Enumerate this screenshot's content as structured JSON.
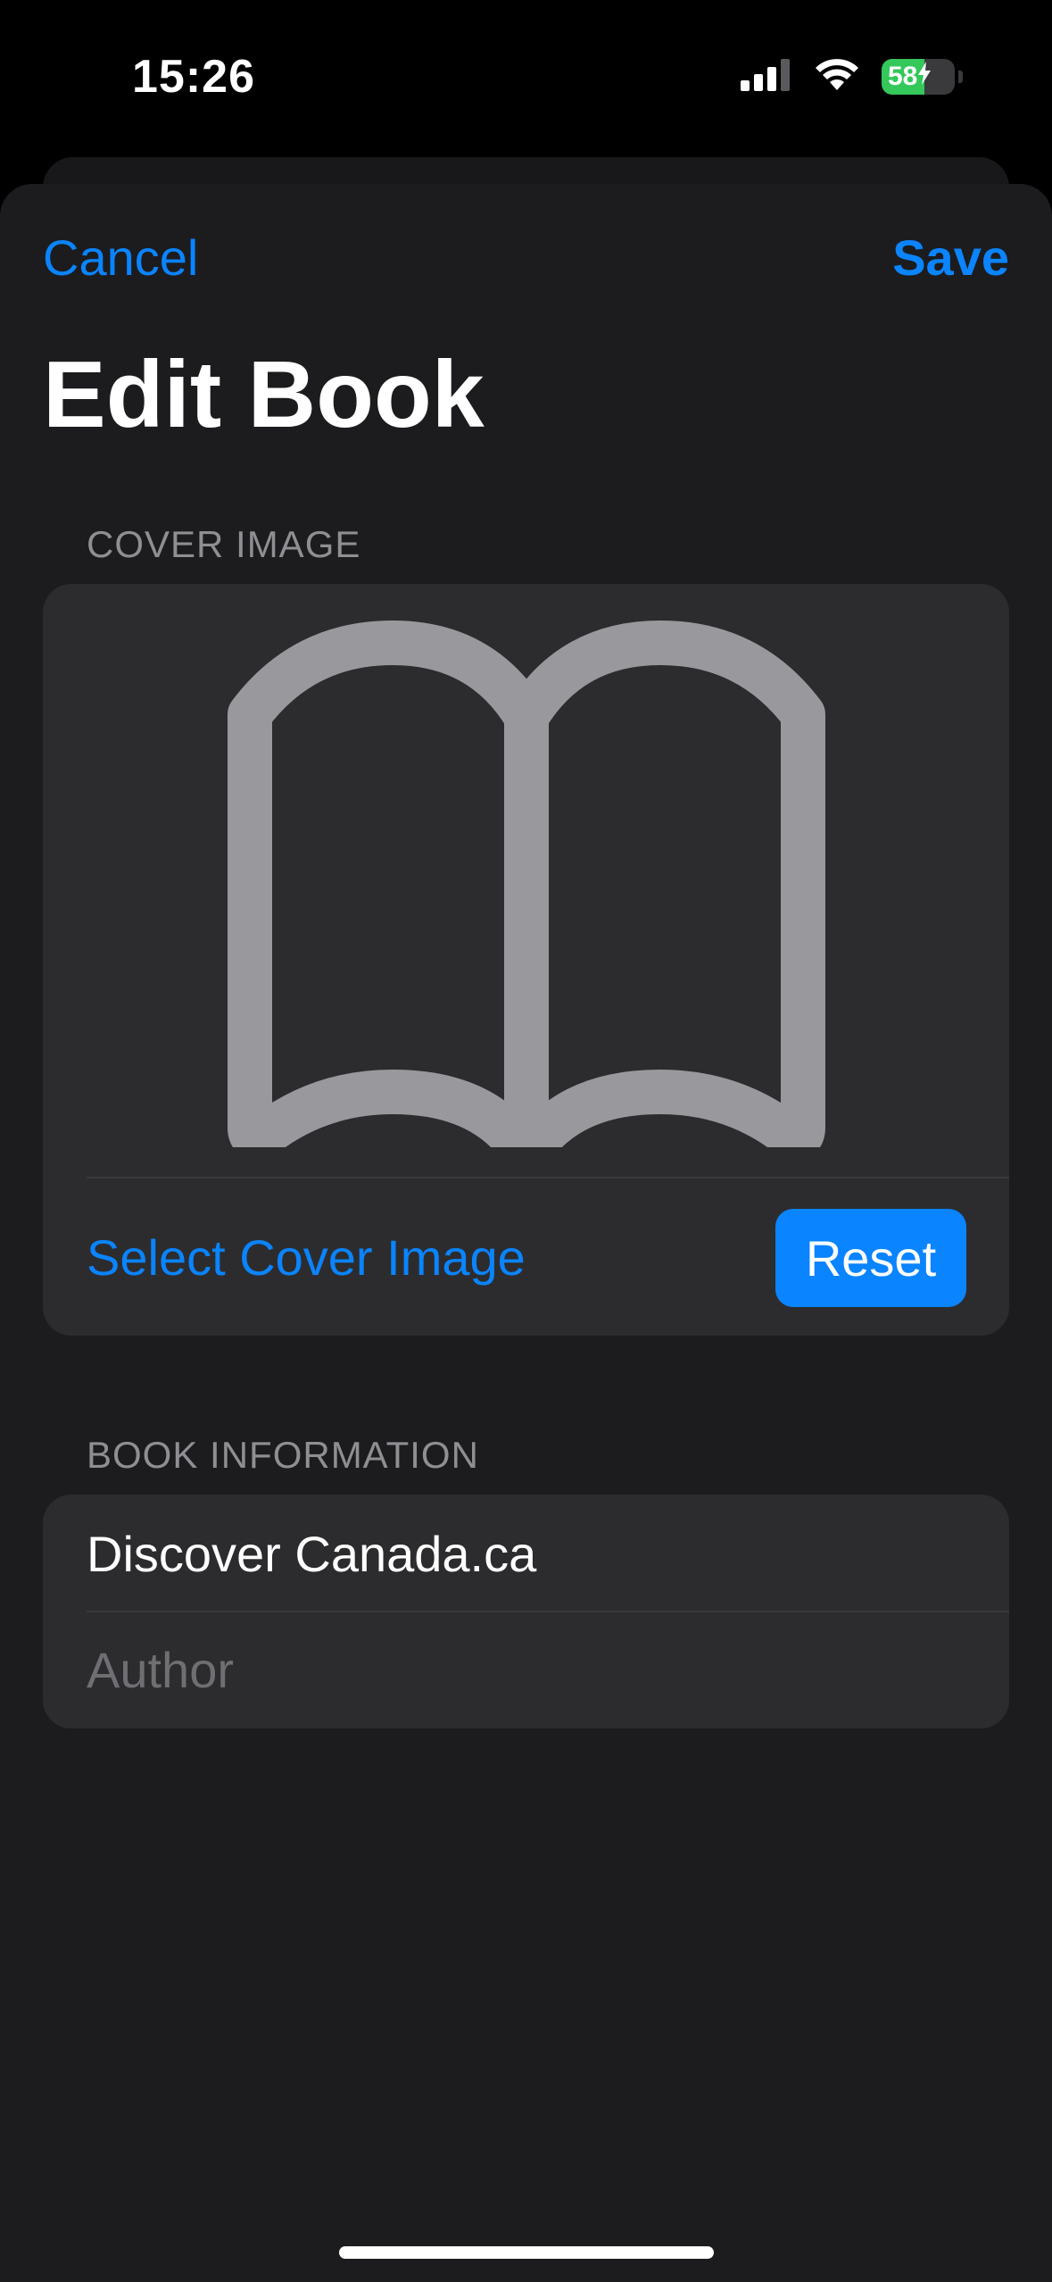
{
  "status_bar": {
    "time": "15:26",
    "battery_level": "58",
    "battery_fraction": 0.58,
    "signal_icon": "cellular-signal-icon",
    "wifi_icon": "wifi-icon",
    "charging_icon": "charging-bolt-icon"
  },
  "nav": {
    "cancel_label": "Cancel",
    "save_label": "Save"
  },
  "title": "Edit Book",
  "cover_section": {
    "header": "COVER IMAGE",
    "placeholder_icon": "book-open-icon",
    "select_label": "Select Cover Image",
    "reset_label": "Reset"
  },
  "info_section": {
    "header": "BOOK INFORMATION",
    "title_value": "Discover Canada.ca",
    "author_value": "",
    "author_placeholder": "Author"
  },
  "colors": {
    "accent": "#0a84ff",
    "background": "#1c1c1e",
    "card": "#2c2c2e",
    "icon_gray": "#98989d"
  }
}
